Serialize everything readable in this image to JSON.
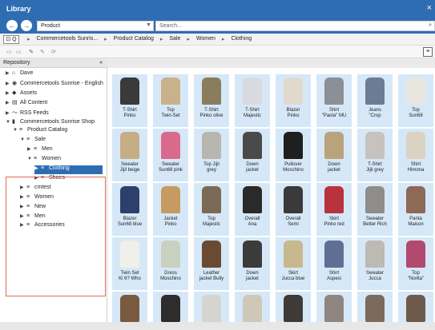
{
  "window": {
    "title": "Library",
    "close": "×"
  },
  "nav": {
    "back": "←",
    "forward": "→"
  },
  "scope": {
    "value": "Product",
    "arrow": "▼"
  },
  "search": {
    "placeholder": "Search...",
    "icon": "⌕"
  },
  "crumbs": {
    "view": "⊡ Q",
    "items": [
      "Commercetools Sunris...",
      "Product Catalog",
      "Sale",
      "Women",
      "Clothing"
    ]
  },
  "toolbar": {
    "tools": [
      "▭",
      "▭",
      "✎",
      "✎",
      "⟳"
    ],
    "list": "≡"
  },
  "repository": {
    "title": "Repository",
    "collapse": "«"
  },
  "tree": [
    {
      "label": "Dave",
      "indent": 0,
      "tri": "▶",
      "icon": "⌂"
    },
    {
      "label": "Commercetools Sunrise - English",
      "indent": 0,
      "tri": "▶",
      "icon": "◉"
    },
    {
      "label": "Assets",
      "indent": 0,
      "tri": "▶",
      "icon": "◆"
    },
    {
      "label": "All Content",
      "indent": 0,
      "tri": "▶",
      "icon": "▤"
    },
    {
      "label": "RSS Feeds",
      "indent": 0,
      "tri": "▶",
      "icon": "〜"
    },
    {
      "label": "Commercetools Sunrise Shop",
      "indent": 0,
      "tri": "▼",
      "icon": "▮"
    },
    {
      "label": "Product Catalog",
      "indent": 1,
      "tri": "▼",
      "icon": "≡"
    },
    {
      "label": "Sale",
      "indent": 2,
      "tri": "▼",
      "icon": "≡"
    },
    {
      "label": "Men",
      "indent": 3,
      "tri": "▶",
      "icon": "≡"
    },
    {
      "label": "Women",
      "indent": 3,
      "tri": "▼",
      "icon": "≡"
    },
    {
      "label": "Clothing",
      "indent": 4,
      "tri": "▶",
      "icon": "≡",
      "selected": true
    },
    {
      "label": "Shoes",
      "indent": 4,
      "tri": "▶",
      "icon": "≡"
    },
    {
      "label": "cmtest",
      "indent": 2,
      "tri": "▶",
      "icon": "≡"
    },
    {
      "label": "Women",
      "indent": 2,
      "tri": "▶",
      "icon": "≡"
    },
    {
      "label": "New",
      "indent": 2,
      "tri": "▶",
      "icon": "≡"
    },
    {
      "label": "Men",
      "indent": 2,
      "tri": "▶",
      "icon": "≡"
    },
    {
      "label": "Accessories",
      "indent": 2,
      "tri": "▶",
      "icon": "≡"
    }
  ],
  "grid": {
    "rows": [
      [
        {
          "l1": "T-Shirt",
          "l2": "Pinko",
          "color": "#3a3a3a"
        },
        {
          "l1": "Top",
          "l2": "Twin-Set",
          "color": "#c9b18b"
        },
        {
          "l1": "T-Shirt",
          "l2": "Pinko olive",
          "color": "#8a7d5e"
        },
        {
          "l1": "T-Shirt",
          "l2": "Majestic",
          "color": "#d9dadf"
        },
        {
          "l1": "Blazer",
          "l2": "Pinko",
          "color": "#e2d9ce"
        },
        {
          "l1": "Shirt",
          "l2": "\"Paola\" MU",
          "color": "#8b8f96"
        },
        {
          "l1": "Jeans",
          "l2": "\"Crop",
          "color": "#6d7c95"
        },
        {
          "l1": "Top",
          "l2": "Sun68",
          "color": "#e9e6df"
        }
      ],
      [
        {
          "l1": "Sweater",
          "l2": "Jijil beige",
          "color": "#c7ad85"
        },
        {
          "l1": "Sweater",
          "l2": "Sun68 pink",
          "color": "#d96a8e"
        },
        {
          "l1": "Top Jijil",
          "l2": "grey",
          "color": "#b9b6b0"
        },
        {
          "l1": "Down",
          "l2": "jacket",
          "color": "#4a4a4a"
        },
        {
          "l1": "Pullover",
          "l2": "Moschino",
          "color": "#1f1f1f"
        },
        {
          "l1": "Down",
          "l2": "jacket",
          "color": "#b9a37a"
        },
        {
          "l1": "T-Shirt",
          "l2": "Jijil grey",
          "color": "#c6c2bd"
        },
        {
          "l1": "Shirt",
          "l2": "Himona",
          "color": "#dcd2c4"
        }
      ],
      [
        {
          "l1": "Blazer",
          "l2": "Sun68 blue",
          "color": "#2d3f6b"
        },
        {
          "l1": "Jacket",
          "l2": "Pinko",
          "color": "#c59b61"
        },
        {
          "l1": "Top",
          "l2": "Majestic",
          "color": "#7a6a55"
        },
        {
          "l1": "Overall",
          "l2": "Ana",
          "color": "#2a2a2a"
        },
        {
          "l1": "Overall",
          "l2": "Semi",
          "color": "#3a3a3a"
        },
        {
          "l1": "Skirt",
          "l2": "Pinko red",
          "color": "#b8333c"
        },
        {
          "l1": "Sweater",
          "l2": "Better Rich",
          "color": "#8f8d8a"
        },
        {
          "l1": "Panta",
          "l2": "Maison",
          "color": "#8c6a55"
        }
      ],
      [
        {
          "l1": "Twin Set",
          "l2": "Ki 6? Who",
          "color": "#f1efe9"
        },
        {
          "l1": "Dress",
          "l2": "Moschino",
          "color": "#c8d1c0"
        },
        {
          "l1": "Leather",
          "l2": "jacket Bully",
          "color": "#6b4a33"
        },
        {
          "l1": "Down",
          "l2": "jacket",
          "color": "#3b3b3b"
        },
        {
          "l1": "Skirt",
          "l2": "Jucca blue",
          "color": "#c8b88e"
        },
        {
          "l1": "Shirt",
          "l2": "Aspesi",
          "color": "#5e6f93"
        },
        {
          "l1": "Sweater",
          "l2": "Jucca",
          "color": "#bdb9b3"
        },
        {
          "l1": "Top",
          "l2": "\"Norita\"",
          "color": "#b24a6f"
        }
      ],
      [
        {
          "l1": "",
          "l2": "",
          "color": "#7a5a3f"
        },
        {
          "l1": "",
          "l2": "",
          "color": "#2d2d2d"
        },
        {
          "l1": "",
          "l2": "",
          "color": "#d6d4cf"
        },
        {
          "l1": "",
          "l2": "",
          "color": "#cfc7b8"
        },
        {
          "l1": "",
          "l2": "",
          "color": "#3f3a35"
        },
        {
          "l1": "",
          "l2": "",
          "color": "#8f8580"
        },
        {
          "l1": "",
          "l2": "",
          "color": "#7c6a5c"
        },
        {
          "l1": "",
          "l2": "",
          "color": "#6e5a4a"
        }
      ]
    ]
  },
  "colors": {
    "accent": "#2f6db3",
    "tile": "#d6e8f7",
    "highlight": "#e36b50"
  }
}
